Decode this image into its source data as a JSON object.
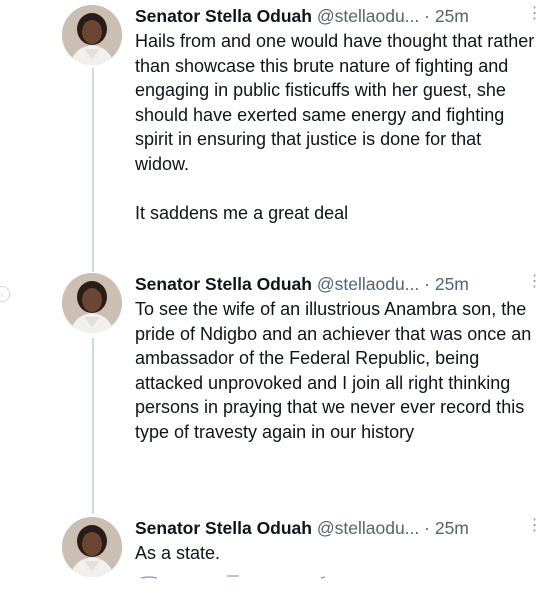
{
  "tweets": [
    {
      "author_name": "Senator Stella Oduah",
      "handle": "@stellaodu...",
      "separator": "·",
      "time": "25m",
      "text": "Hails from and one would have thought that rather than showcase this brute nature of fighting and engaging in public fisticuffs with her guest, she should have exerted same energy and fighting spirit in ensuring that justice is done for that widow.\n\nIt saddens me a great deal"
    },
    {
      "author_name": "Senator Stella Oduah",
      "handle": "@stellaodu...",
      "separator": "·",
      "time": "25m",
      "text": "To see the wife of an illustrious Anambra son, the pride of Ndigbo and an achiever that was once an ambassador of the Federal Republic, being attacked unprovoked and I join all right thinking persons in praying that we never ever record this type of travesty again in our history"
    },
    {
      "author_name": "Senator Stella Oduah",
      "handle": "@stellaodu...",
      "separator": "·",
      "time": "25m",
      "text": "As a state."
    }
  ],
  "icons": {
    "more": "more-vertical-icon",
    "avatar": "avatar-photo"
  },
  "colors": {
    "thread_line": "#cfd9de",
    "secondary_text": "#536471"
  }
}
